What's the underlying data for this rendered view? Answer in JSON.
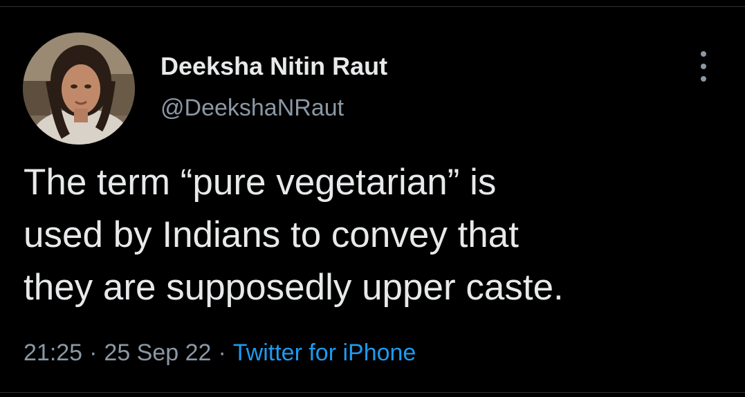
{
  "author": {
    "display_name": "Deeksha Nitin Raut",
    "handle": "@DeekshaNRaut",
    "avatar_icon": "profile-photo"
  },
  "tweet": {
    "lines": [
      "The term “pure vegetarian” is",
      "used by Indians to convey that",
      "they are supposedly upper caste."
    ]
  },
  "meta": {
    "time": "21:25",
    "separator": "·",
    "date": "25 Sep 22",
    "source": "Twitter for iPhone"
  },
  "more_icon": "more-vertical-icon",
  "colors": {
    "background": "#000000",
    "text_primary": "#e7e9ea",
    "text_secondary": "#8b98a5",
    "link": "#1d9bf0",
    "divider": "#2f3336"
  }
}
